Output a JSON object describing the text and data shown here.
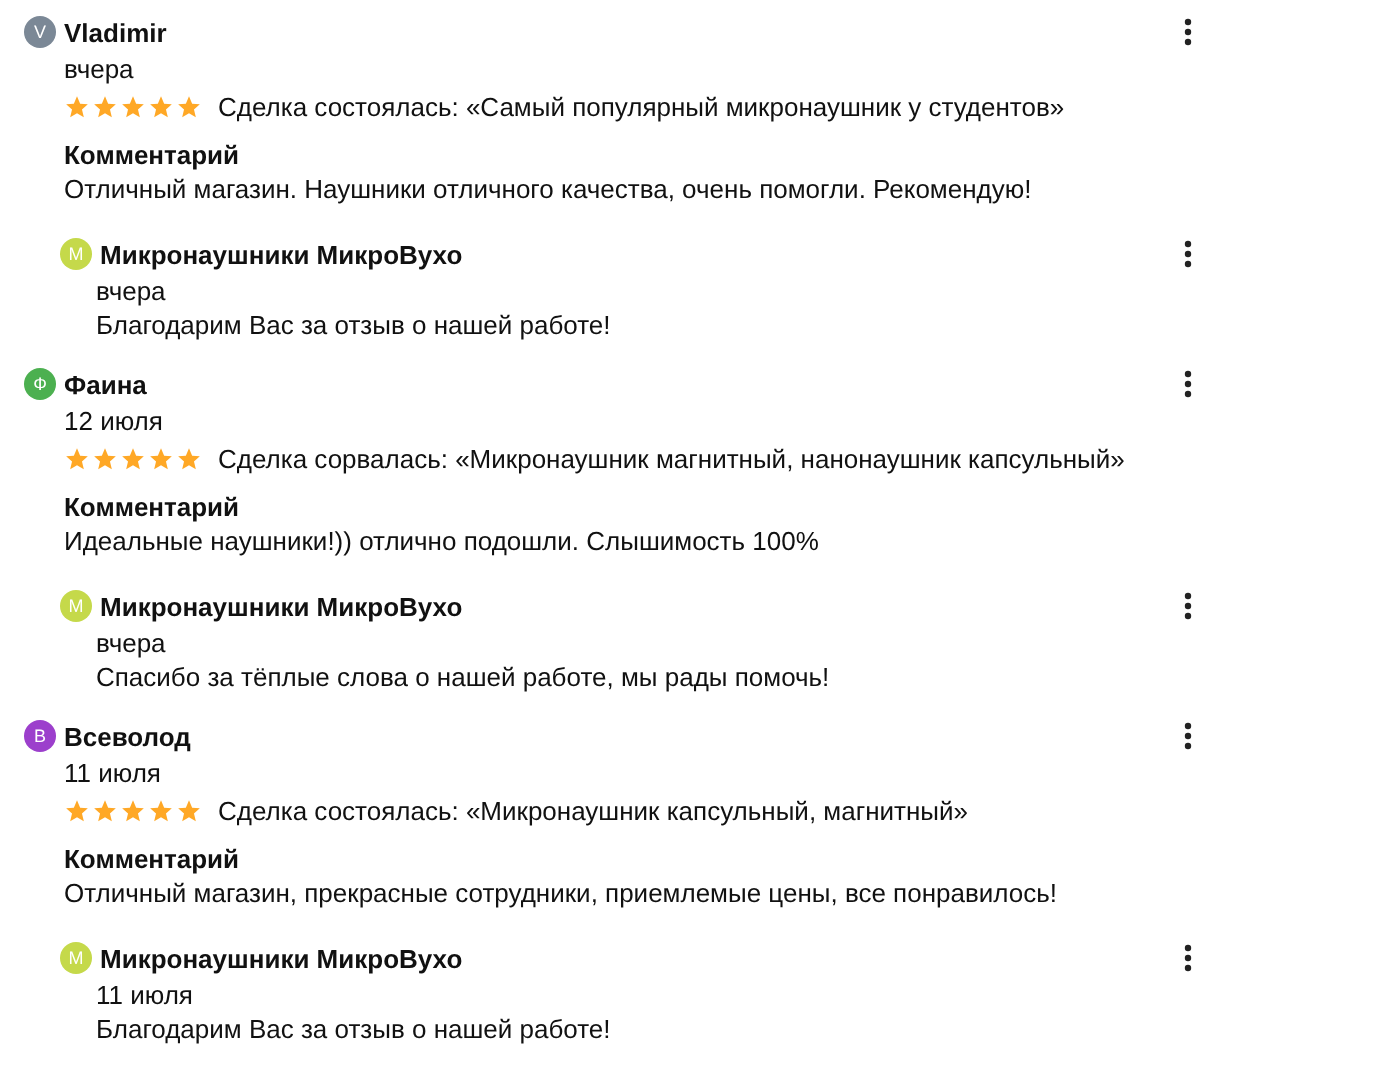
{
  "reviews": [
    {
      "avatar_letter": "V",
      "color": "#7b8896",
      "name": "Vladimir",
      "date": "вчера",
      "stars": 5,
      "deal": "Сделка состоялась: «Самый популярный микронаушник у студентов»",
      "comment_label": "Комментарий",
      "comment": "Отличный магазин. Наушники отличного качества, очень помогли. Рекомендую!",
      "reply": {
        "avatar_letter": "М",
        "color": "#c5d94a",
        "name": "Микронаушники МикроВухо",
        "date": "вчера",
        "text": "Благодарим Вас за отзыв о нашей работе!"
      }
    },
    {
      "avatar_letter": "Ф",
      "color": "#4cb050",
      "name": "Фаина",
      "date": "12 июля",
      "stars": 5,
      "deal": "Сделка сорвалась: «Микронаушник магнитный, нанонаушник капсульный»",
      "comment_label": "Комментарий",
      "comment": "Идеальные наушники!)) отлично подошли. Слышимость 100%",
      "reply": {
        "avatar_letter": "М",
        "color": "#c5d94a",
        "name": "Микронаушники МикроВухо",
        "date": "вчера",
        "text": "Спасибо за тёплые слова о нашей работе, мы рады помочь!"
      }
    },
    {
      "avatar_letter": "В",
      "color": "#9c3fcc",
      "name": "Всеволод",
      "date": "11 июля",
      "stars": 5,
      "deal": "Сделка состоялась: «Микронаушник капсульный, магнитный»",
      "comment_label": "Комментарий",
      "comment": "Отличный магазин, прекрасные сотрудники, приемлемые цены, все понравилось!",
      "reply": {
        "avatar_letter": "М",
        "color": "#c5d94a",
        "name": "Микронаушники МикроВухо",
        "date": "11 июля",
        "text": "Благодарим Вас за отзыв о нашей работе!"
      }
    }
  ]
}
